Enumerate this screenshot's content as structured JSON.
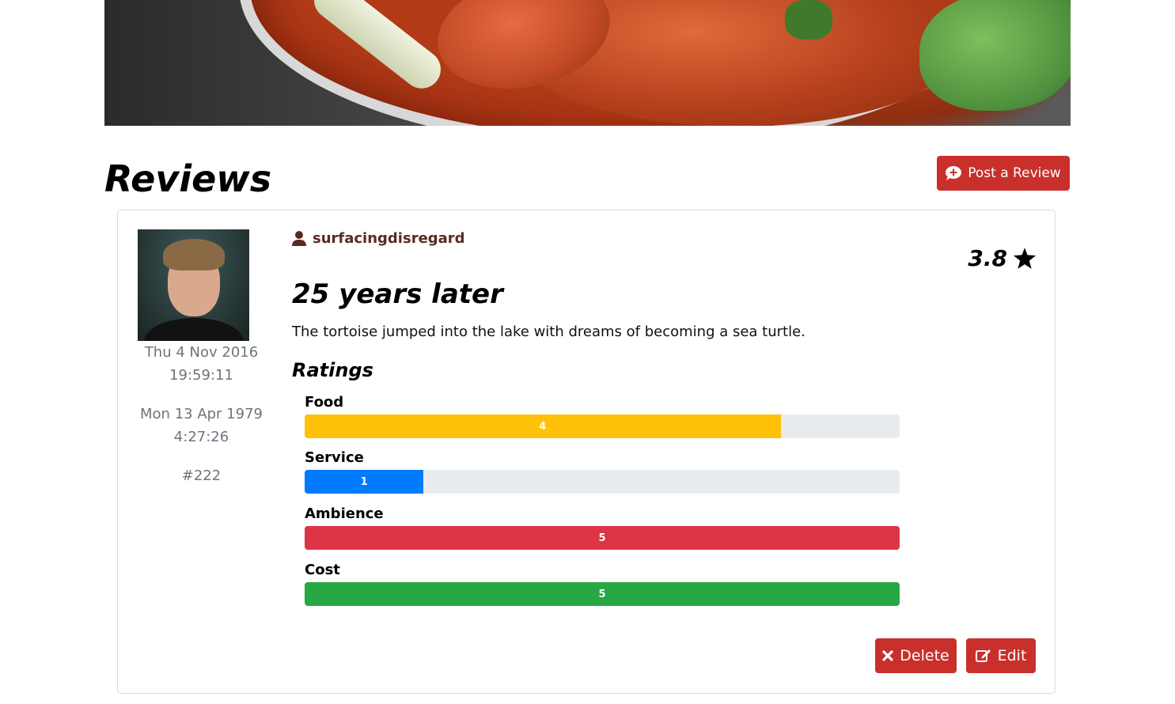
{
  "page": {
    "heading": "Reviews",
    "post_button_label": "Post a Review"
  },
  "review": {
    "author": "surfacingdisregard",
    "score": "3.8",
    "title": "25 years later",
    "body": "The tortoise jumped into the lake with dreams of becoming a sea turtle.",
    "created_date": "Thu 4 Nov 2016",
    "created_time": "19:59:11",
    "second_date": "Mon 13 Apr 1979",
    "second_time": "4:27:26",
    "id_label": "#222",
    "ratings_heading": "Ratings",
    "ratings": [
      {
        "label": "Food",
        "value": 4,
        "max": 5,
        "color": "#ffc107"
      },
      {
        "label": "Service",
        "value": 1,
        "max": 5,
        "color": "#007bff"
      },
      {
        "label": "Ambience",
        "value": 5,
        "max": 5,
        "color": "#dc3545"
      },
      {
        "label": "Cost",
        "value": 5,
        "max": 5,
        "color": "#28a745"
      }
    ],
    "delete_label": "Delete",
    "edit_label": "Edit"
  },
  "colors": {
    "button_red": "#c9302c",
    "author_color": "#5a2a22",
    "muted_text": "#6c757d"
  },
  "icons": [
    "comment-plus-icon",
    "user-icon",
    "star-icon",
    "close-icon",
    "edit-icon"
  ]
}
